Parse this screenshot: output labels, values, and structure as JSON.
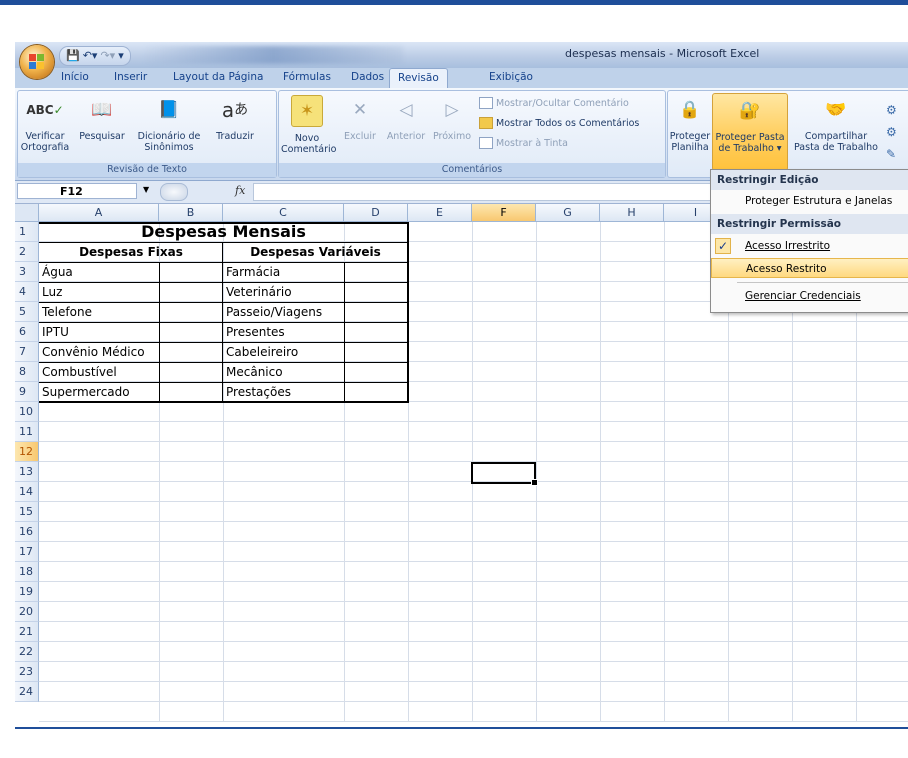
{
  "window": {
    "title": "despesas mensais - Microsoft Excel"
  },
  "tabs": [
    "Início",
    "Inserir",
    "Layout da Página",
    "Fórmulas",
    "Dados",
    "Revisão",
    "Exibição"
  ],
  "active_tab": "Revisão",
  "ribbon": {
    "revisao_texto": {
      "label": "Revisão de Texto",
      "verificar": "Verificar",
      "ortografia": "Ortografia",
      "pesquisar": "Pesquisar",
      "dicionario": "Dicionário de",
      "sinonimos": "Sinônimos",
      "traduzir": "Traduzir"
    },
    "comentarios": {
      "label": "Comentários",
      "novo": "Novo",
      "comentario": "Comentário",
      "excluir": "Excluir",
      "anterior": "Anterior",
      "proximo": "Próximo",
      "mostrar_ocultar": "Mostrar/Ocultar Comentário",
      "mostrar_todos": "Mostrar Todos os Comentários",
      "mostrar_tinta": "Mostrar à Tinta"
    },
    "alteracoes": {
      "proteger": "Proteger",
      "planilha": "Planilha",
      "proteger_pasta": "Proteger Pasta",
      "de_trabalho": "de Trabalho ▾",
      "compartilhar": "Compartilhar",
      "pasta_de_trabalho": "Pasta de Trabalho"
    }
  },
  "formula_bar": {
    "name_box": "F12",
    "fx": "fx",
    "value": ""
  },
  "columns": [
    "A",
    "B",
    "C",
    "D",
    "E",
    "F",
    "G",
    "H",
    "I"
  ],
  "selected_column": "F",
  "selected_row": "12",
  "rows": [
    "1",
    "2",
    "3",
    "4",
    "5",
    "6",
    "7",
    "8",
    "9",
    "10",
    "11",
    "12",
    "13",
    "14",
    "15",
    "16",
    "17",
    "18",
    "19",
    "20",
    "21",
    "22",
    "23",
    "24"
  ],
  "sheet": {
    "title": "Despesas Mensais",
    "fixed_header": "Despesas Fixas",
    "variable_header": "Despesas Variáveis",
    "fixed_items": [
      "Água",
      "Luz",
      "Telefone",
      "IPTU",
      "Convênio Médico",
      "Combustível",
      "Supermercado"
    ],
    "variable_items": [
      "Farmácia",
      "Veterinário",
      "Passeio/Viagens",
      "Presentes",
      "Cabeleireiro",
      "Mecânico",
      "Prestações"
    ]
  },
  "menu": {
    "section1": "Restringir Edição",
    "item1": "Proteger Estrutura e Janelas",
    "section2": "Restringir Permissão",
    "item2": "Acesso Irrestrito",
    "item3": "Acesso Restrito",
    "item4": "Gerenciar Credenciais"
  },
  "colors": {
    "accent": "#1f4e9a",
    "highlight": "#ffd980",
    "ribbon": "#dce7f5"
  }
}
